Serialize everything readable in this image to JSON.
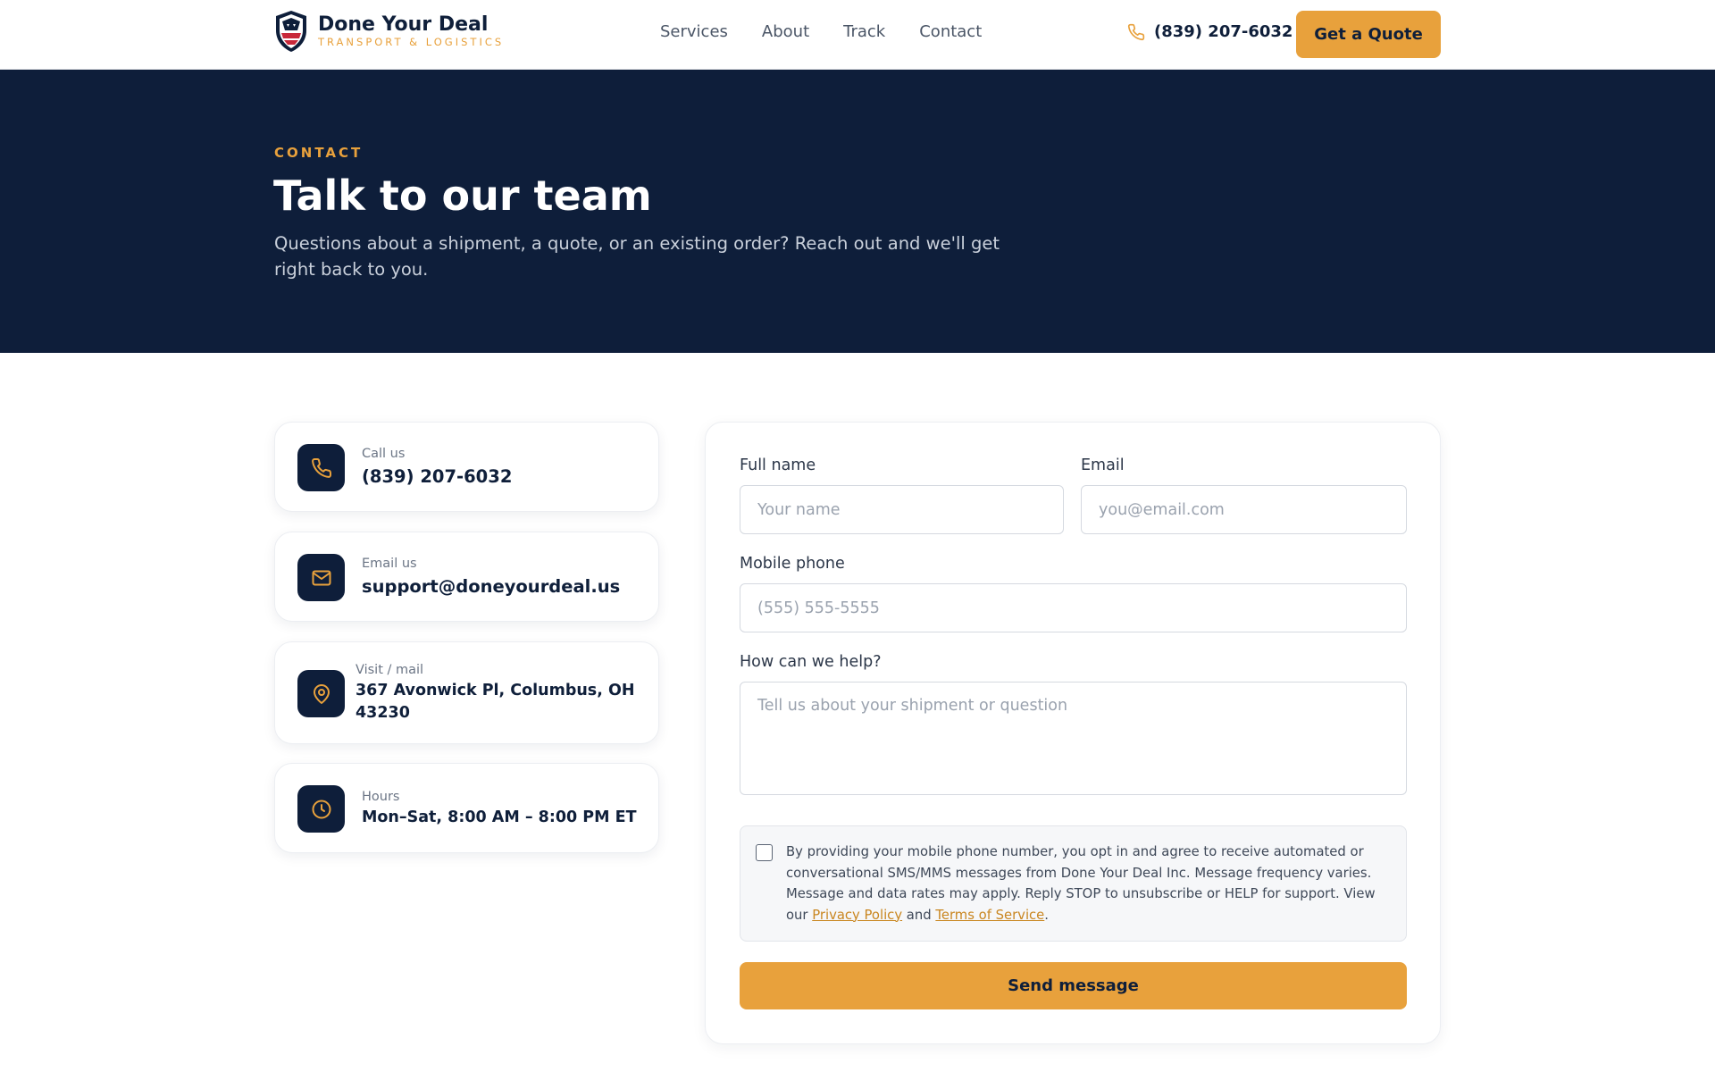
{
  "header": {
    "brand_name": "Done Your Deal",
    "brand_tagline": "TRANSPORT & LOGISTICS",
    "nav": [
      "Services",
      "About",
      "Track",
      "Contact"
    ],
    "phone": "(839) 207-6032",
    "quote_label": "Get a Quote"
  },
  "hero": {
    "eyebrow": "CONTACT",
    "title": "Talk to our team",
    "subtitle": "Questions about a shipment, a quote, or an existing order? Reach out and we'll get right back to you."
  },
  "contact_cards": [
    {
      "label": "Call us",
      "value": "(839) 207-6032",
      "icon": "phone-icon"
    },
    {
      "label": "Email us",
      "value": "support@doneyourdeal.us",
      "icon": "mail-icon"
    },
    {
      "label": "Visit / mail",
      "value": "367 Avonwick Pl, Columbus, OH 43230",
      "icon": "map-pin-icon"
    },
    {
      "label": "Hours",
      "value": "Mon–Sat, 8:00 AM – 8:00 PM ET",
      "icon": "clock-icon"
    }
  ],
  "form": {
    "full_name_label": "Full name",
    "full_name_placeholder": "Your name",
    "email_label": "Email",
    "email_placeholder": "you@email.com",
    "phone_label": "Mobile phone",
    "phone_placeholder": "(555) 555-5555",
    "help_label": "How can we help?",
    "help_placeholder": "Tell us about your shipment or question",
    "consent_text": "By providing your mobile phone number, you opt in and agree to receive automated or conversational SMS/MMS messages from Done Your Deal Inc. Message frequency varies. Message and data rates may apply. Reply STOP to unsubscribe or HELP for support. View our",
    "privacy_link": "Privacy Policy",
    "consent_and": "and",
    "terms_link": "Terms of Service",
    "consent_end": ".",
    "submit_label": "Send message"
  },
  "colors": {
    "navy": "#0e1e3a",
    "accent": "#e8a13c"
  }
}
